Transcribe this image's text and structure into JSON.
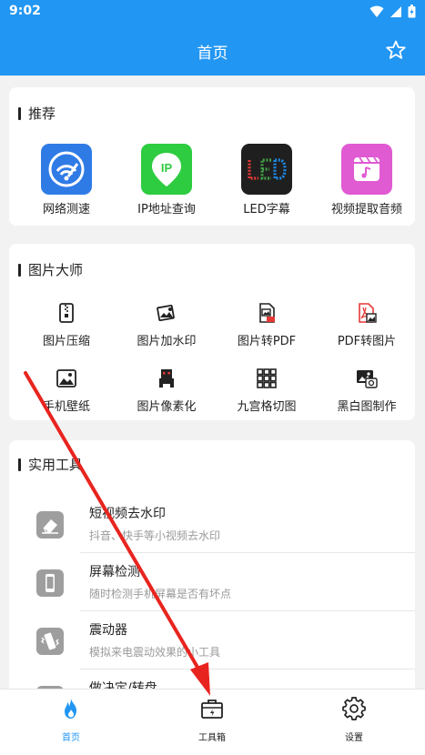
{
  "status_bar": {
    "time": "9:02"
  },
  "app_bar": {
    "title": "首页",
    "star_icon": "star-outline-icon"
  },
  "recommend": {
    "title": "推荐",
    "items": [
      {
        "label": "网络测速",
        "icon": "speedometer-wifi-icon",
        "color": "#2f7be6"
      },
      {
        "label": "IP地址查询",
        "icon": "ip-pin-icon",
        "color": "#2ecc40"
      },
      {
        "label": "LED字幕",
        "icon": "led-icon",
        "color": "#1f1f1f"
      },
      {
        "label": "视频提取音频",
        "icon": "video-music-icon",
        "color": "#e05ad2"
      }
    ]
  },
  "image_master": {
    "title": "图片大师",
    "items": [
      {
        "label": "图片压缩",
        "icon": "zip-file-icon"
      },
      {
        "label": "图片加水印",
        "icon": "watermark-image-icon"
      },
      {
        "label": "图片转PDF",
        "icon": "image-to-pdf-icon"
      },
      {
        "label": "PDF转图片",
        "icon": "pdf-to-image-icon"
      },
      {
        "label": "手机壁纸",
        "icon": "wallpaper-icon"
      },
      {
        "label": "图片像素化",
        "icon": "pixel-icon"
      },
      {
        "label": "九宫格切图",
        "icon": "grid-nine-icon"
      },
      {
        "label": "黑白图制作",
        "icon": "black-white-image-icon"
      }
    ]
  },
  "tools": {
    "title": "实用工具",
    "items": [
      {
        "name": "短视频去水印",
        "desc": "抖音、快手等小视频去水印",
        "icon": "eraser-icon"
      },
      {
        "name": "屏幕检测",
        "desc": "随时检测手机屏幕是否有坏点",
        "icon": "phone-screen-icon"
      },
      {
        "name": "震动器",
        "desc": "模拟来电震动效果的小工具",
        "icon": "vibrate-icon"
      },
      {
        "name": "做决定/转盘",
        "desc": "",
        "icon": "wheel-icon"
      }
    ]
  },
  "bottom_nav": {
    "items": [
      {
        "label": "首页",
        "icon": "flame-icon",
        "active": true
      },
      {
        "label": "工具箱",
        "icon": "toolbox-icon",
        "active": false
      },
      {
        "label": "设置",
        "icon": "gear-icon",
        "active": false
      }
    ]
  },
  "accent": "#2196f3",
  "annotation_color": "#e8241f"
}
